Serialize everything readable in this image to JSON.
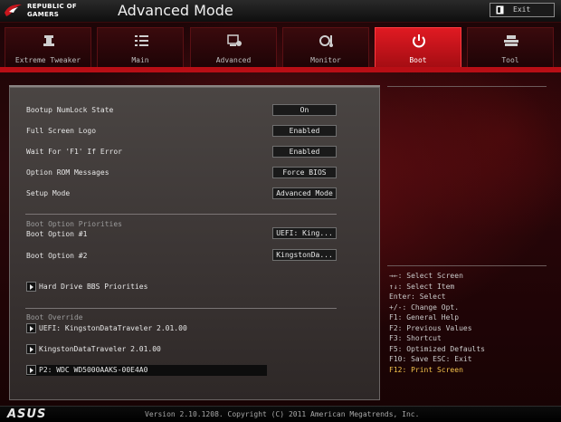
{
  "header": {
    "brand_line1": "REPUBLIC OF",
    "brand_line2": "GAMERS",
    "title": "Advanced Mode",
    "exit_label": "Exit"
  },
  "tabs": [
    {
      "label": "Extreme Tweaker",
      "icon": "tweaker-icon",
      "active": false
    },
    {
      "label": "Main",
      "icon": "list-icon",
      "active": false
    },
    {
      "label": "Advanced",
      "icon": "advanced-icon",
      "active": false
    },
    {
      "label": "Monitor",
      "icon": "monitor-icon",
      "active": false
    },
    {
      "label": "Boot",
      "icon": "power-icon",
      "active": true
    },
    {
      "label": "Tool",
      "icon": "tool-icon",
      "active": false
    }
  ],
  "settings": [
    {
      "label": "Bootup NumLock State",
      "value": "On"
    },
    {
      "label": "Full Screen Logo",
      "value": "Enabled"
    },
    {
      "label": "Wait For 'F1' If Error",
      "value": "Enabled"
    },
    {
      "label": "Option ROM Messages",
      "value": "Force BIOS"
    },
    {
      "label": "Setup Mode",
      "value": "Advanced Mode"
    }
  ],
  "boot_priorities": {
    "title": "Boot Option Priorities",
    "options": [
      {
        "label": "Boot Option #1",
        "value": "UEFI: King..."
      },
      {
        "label": "Boot Option #2",
        "value": "KingstonDa..."
      }
    ]
  },
  "submenus": {
    "hdd_bbs": "Hard Drive BBS Priorities"
  },
  "boot_override": {
    "title": "Boot Override",
    "items": [
      "UEFI: KingstonDataTraveler 2.01.00",
      "KingstonDataTraveler 2.01.00",
      "P2: WDC WD5000AAKS-00E4A0"
    ]
  },
  "help": [
    {
      "text": "→←: Select Screen",
      "highlight": false
    },
    {
      "text": "↑↓: Select Item",
      "highlight": false
    },
    {
      "text": "Enter: Select",
      "highlight": false
    },
    {
      "text": "+/-: Change Opt.",
      "highlight": false
    },
    {
      "text": "F1: General Help",
      "highlight": false
    },
    {
      "text": "F2: Previous Values",
      "highlight": false
    },
    {
      "text": "F3: Shortcut",
      "highlight": false
    },
    {
      "text": "F5: Optimized Defaults",
      "highlight": false
    },
    {
      "text": "F10: Save  ESC: Exit",
      "highlight": false
    },
    {
      "text": "F12: Print Screen",
      "highlight": true
    }
  ],
  "footer": {
    "logo": "ASUS",
    "version": "Version 2.10.1208. Copyright (C) 2011 American Megatrends, Inc."
  },
  "colors": {
    "accent_red": "#e01a22",
    "highlight_yellow": "#f2c14b"
  }
}
